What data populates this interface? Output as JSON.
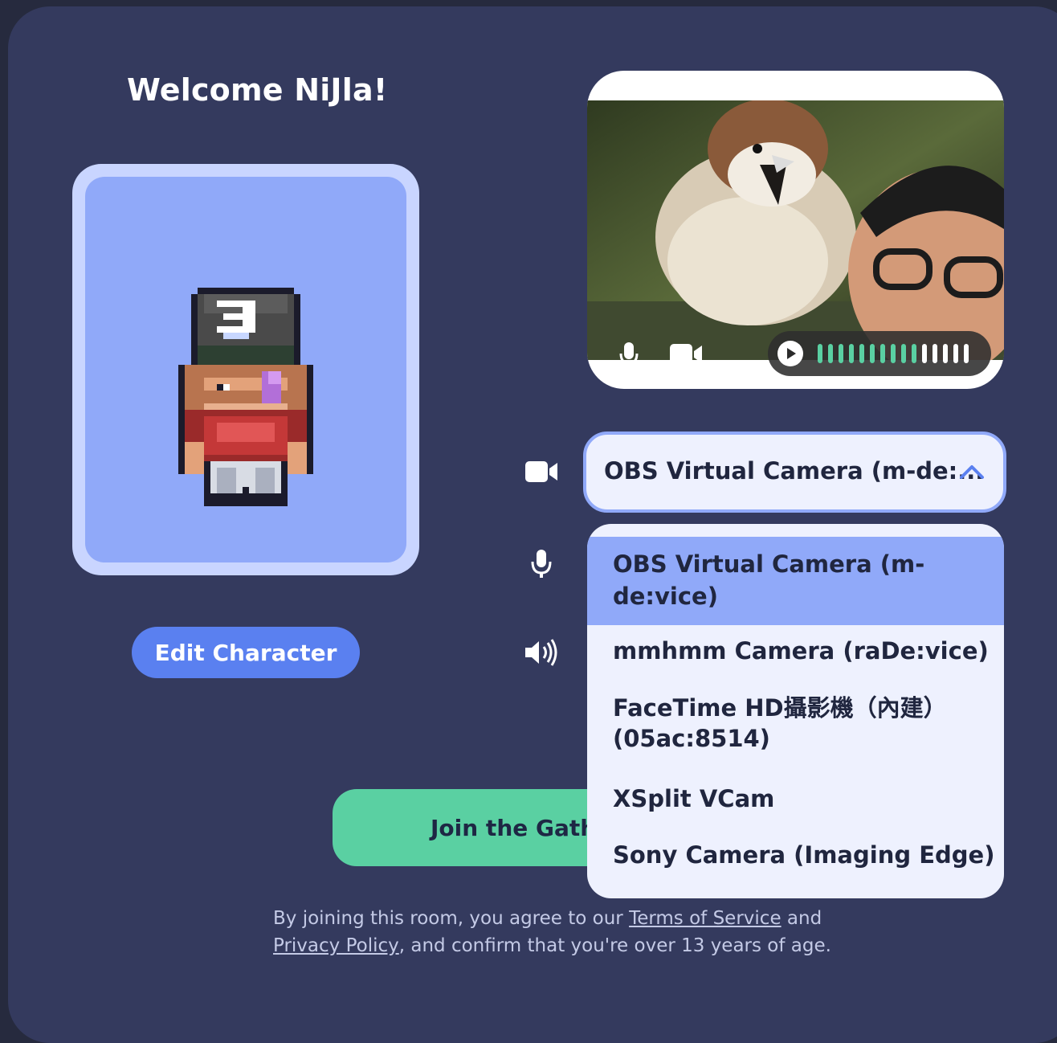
{
  "welcome": {
    "title": "Welcome NiJla!"
  },
  "avatar": {
    "edit_label": "Edit Character"
  },
  "preview": {
    "mic_icon": "mic-icon",
    "camera_icon": "video-camera-icon",
    "play_icon": "play-icon",
    "level_bars_lit": 10,
    "level_bars_total": 15
  },
  "devices": {
    "camera_icon": "video-camera-icon",
    "mic_icon": "mic-icon",
    "speaker_icon": "speaker-icon",
    "camera_selected": "OBS Virtual Camera (m-de:...",
    "camera_options": [
      {
        "line1": "OBS Virtual Camera (m-",
        "line2": "de:vice)",
        "selected": true
      },
      {
        "line1": "mmhmm Camera (raDe:vice)",
        "line2": ""
      },
      {
        "line1": "FaceTime HD攝影機（內建）",
        "line2": "(05ac:8514)"
      },
      {
        "line1": "XSplit VCam",
        "line2": ""
      },
      {
        "line1": "Sony Camera (Imaging Edge)",
        "line2": ""
      }
    ]
  },
  "join": {
    "label": "Join the Gathering"
  },
  "terms": {
    "text_1": "By joining this room, you agree to our ",
    "tos": "Terms of Service",
    "text_2": " and",
    "privacy": "Privacy Policy",
    "text_3": ", and confirm that you're over 13 years of age."
  },
  "colors": {
    "panel": "#343a5e",
    "accent_blue": "#5a80f0",
    "join_green": "#5ad0a2",
    "menu_selected": "#90a9f9",
    "meter_green": "#5ad0a2"
  }
}
